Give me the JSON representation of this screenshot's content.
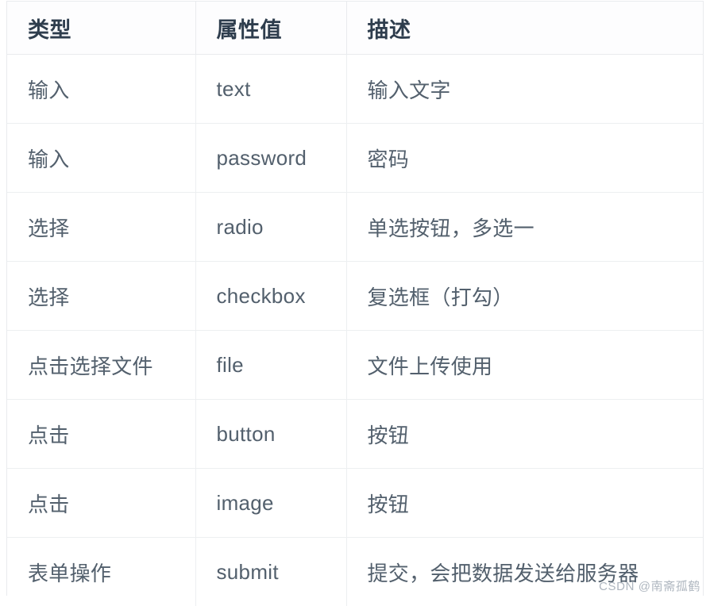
{
  "table": {
    "columns": [
      {
        "key": "type",
        "label": "类型"
      },
      {
        "key": "value",
        "label": "属性值"
      },
      {
        "key": "desc",
        "label": "描述"
      }
    ],
    "rows": [
      {
        "type": "输入",
        "value": "text",
        "desc": "输入文字"
      },
      {
        "type": "输入",
        "value": "password",
        "desc": "密码"
      },
      {
        "type": "选择",
        "value": "radio",
        "desc": "单选按钮，多选一"
      },
      {
        "type": "选择",
        "value": "checkbox",
        "desc": "复选框（打勾）"
      },
      {
        "type": "点击选择文件",
        "value": "file",
        "desc": "文件上传使用"
      },
      {
        "type": "点击",
        "value": "button",
        "desc": "按钮"
      },
      {
        "type": "点击",
        "value": "image",
        "desc": "按钮"
      },
      {
        "type": "表单操作",
        "value": "submit",
        "desc": "提交，会把数据发送给服务器"
      }
    ]
  },
  "watermark": {
    "text": "CSDN @南斋孤鹤"
  },
  "colors": {
    "header_text": "#2e3d4d",
    "body_text": "#53606d",
    "border": "#e9ebee",
    "row_border": "#edeff1",
    "background": "#ffffff",
    "watermark_text": "#aeb6bf"
  }
}
